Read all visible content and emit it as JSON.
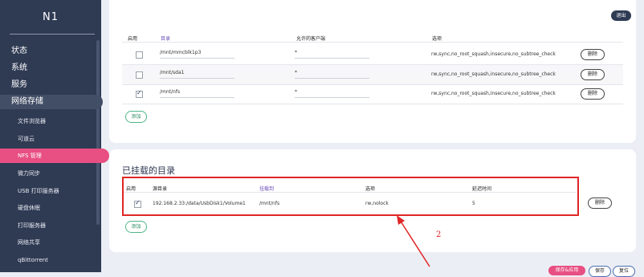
{
  "brand": "N1",
  "nav": {
    "status": "状态",
    "system": "系统",
    "services": "服务",
    "network_storage": "网络存储",
    "file_browser": "文件浏览器",
    "kodexplorer": "可道云",
    "nfs": "NFS 管理",
    "sync": "微力同步",
    "usb_print": "USB 打印服务器",
    "disk_sleep": "硬盘休眠",
    "print_server": "打印服务器",
    "network_share": "网络共享",
    "qbittorrent": "qBittorrent"
  },
  "top_panel": {
    "exit_button": "退出",
    "headers": {
      "enable": "启用",
      "dir": "目录",
      "clients": "允许的客户端",
      "options": "选项"
    },
    "rows": [
      {
        "enabled": false,
        "dir": "/mnt/mmcblk1p3",
        "client": "*",
        "options": "rw,sync,no_root_squash,insecure,no_subtree_check",
        "delete": "删除"
      },
      {
        "enabled": false,
        "dir": "/mnt/sda1",
        "client": "*",
        "options": "rw,sync,no_root_squash,insecure,no_subtree_check",
        "delete": "删除"
      },
      {
        "enabled": true,
        "dir": "/mnt/nfs",
        "client": "*",
        "options": "rw,sync,no_root_squash,insecure,no_subtree_check",
        "delete": "删除"
      }
    ],
    "add_button": "添加"
  },
  "mount_panel": {
    "title": "已挂载的目录",
    "headers": {
      "enable": "启用",
      "source": "源目录",
      "mountpoint": "挂载到",
      "options": "选项",
      "delay": "延迟时间"
    },
    "rows": [
      {
        "enabled": true,
        "source": "192.168.2.33:/data/UsbDisk1/Volume1",
        "mountpoint": "/mnt/nfs",
        "options": "rw,nolock",
        "delay": "5",
        "delete": "删除"
      }
    ],
    "add_button": "添加"
  },
  "annotation": {
    "label": "2",
    "color": "#e02626"
  },
  "footer": {
    "save_apply": "保存&应用",
    "save": "保存",
    "reset": "复位"
  }
}
